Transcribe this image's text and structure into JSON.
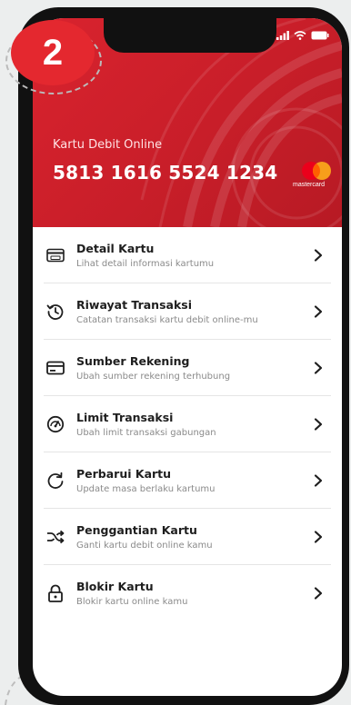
{
  "step": {
    "number": "2"
  },
  "card": {
    "label": "Kartu Debit Online",
    "number": "5813 1616 5524 1234",
    "network": "mastercard"
  },
  "colors": {
    "brand_red": "#d9232e",
    "step_red": "#e4282f",
    "text_dark": "#1e1e1e",
    "text_muted": "#8a8a8a"
  },
  "menu": [
    {
      "title": "Detail Kartu",
      "subtitle": "Lihat detail informasi kartumu",
      "icon": "cvv-card-icon"
    },
    {
      "title": "Riwayat Transaksi",
      "subtitle": "Catatan transaksi kartu debit online-mu",
      "icon": "history-icon"
    },
    {
      "title": "Sumber Rekening",
      "subtitle": "Ubah sumber rekening terhubung",
      "icon": "card-source-icon"
    },
    {
      "title": "Limit Transaksi",
      "subtitle": "Ubah limit transaksi gabungan",
      "icon": "gauge-icon"
    },
    {
      "title": "Perbarui Kartu",
      "subtitle": "Update masa berlaku kartumu",
      "icon": "refresh-icon"
    },
    {
      "title": "Penggantian Kartu",
      "subtitle": "Ganti kartu debit online kamu",
      "icon": "shuffle-icon"
    },
    {
      "title": "Blokir Kartu",
      "subtitle": "Blokir kartu online kamu",
      "icon": "lock-icon"
    }
  ]
}
